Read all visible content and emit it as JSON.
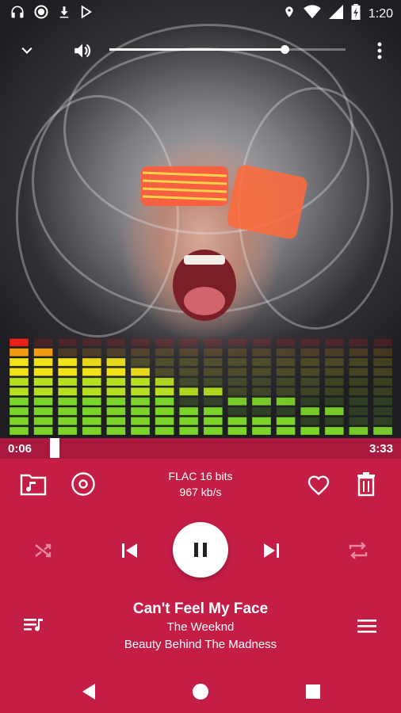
{
  "status_bar": {
    "time": "1:20",
    "left_icons": [
      "headphones-icon",
      "record-icon",
      "download-icon",
      "play-store-icon"
    ],
    "right_icons": [
      "location-icon",
      "wifi-icon",
      "signal-icon",
      "battery-charging-icon"
    ]
  },
  "top_bar": {
    "volume_level": 0.74,
    "icons": [
      "chevron-down-icon",
      "volume-icon",
      "overflow-menu-icon"
    ]
  },
  "equalizer": {
    "bands": [
      10,
      9,
      8,
      7,
      7,
      6,
      5,
      3,
      3,
      2,
      2,
      2,
      1,
      1,
      0,
      0
    ],
    "peaks": [
      10,
      9,
      8,
      8,
      8,
      7,
      6,
      5,
      5,
      4,
      4,
      4,
      3,
      3,
      1,
      1
    ]
  },
  "seek": {
    "elapsed": "0:06",
    "total": "3:33",
    "progress": 0.028
  },
  "format": {
    "codec": "FLAC 16 bits",
    "bitrate": "967 kb/s"
  },
  "track": {
    "title": "Can't Feel My Face",
    "artist": "The Weeknd",
    "album": "Beauty Behind The Madness"
  },
  "colors": {
    "accent": "#c41d46",
    "seek_bar": "#a8193d",
    "disabled_icon": "#e3889e"
  }
}
